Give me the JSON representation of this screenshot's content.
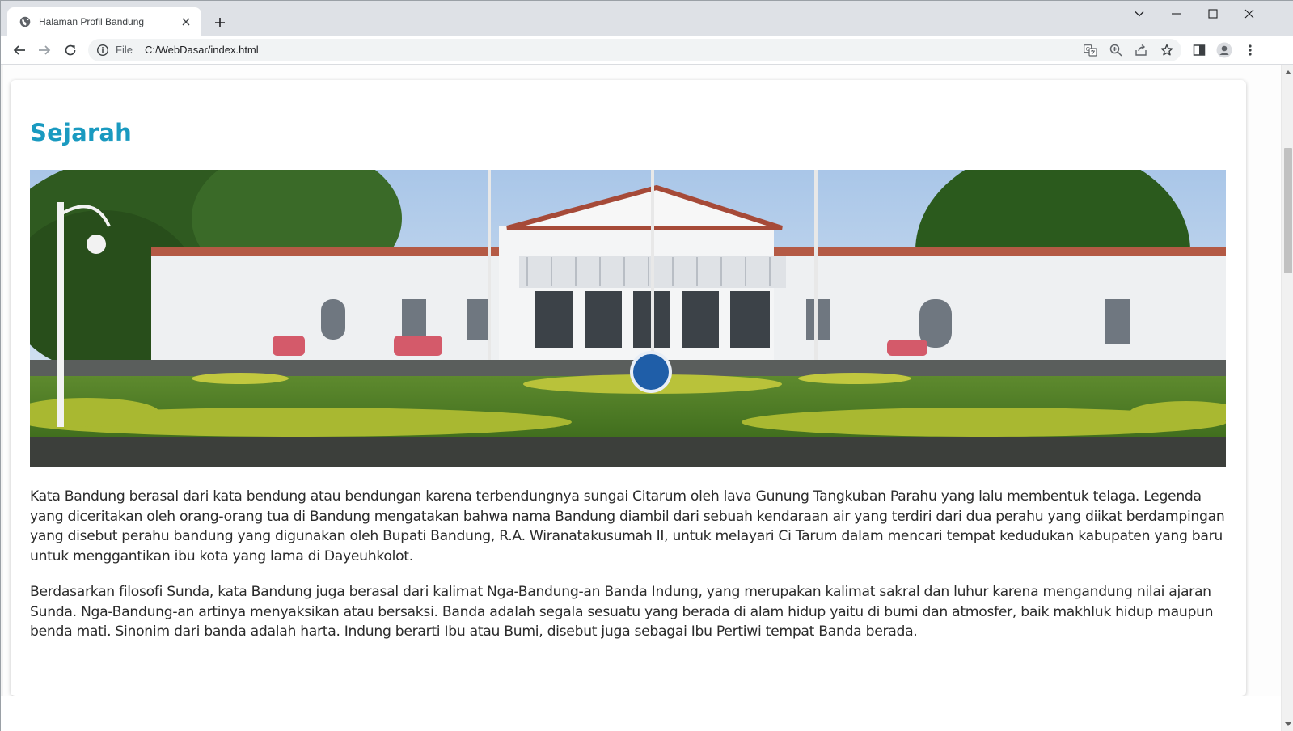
{
  "browser": {
    "tab_title": "Halaman Profil Bandung",
    "address_scheme_label": "File",
    "address_url": "C:/WebDasar/index.html",
    "icons": {
      "favicon": "globe-icon",
      "tab_close": "close-icon",
      "new_tab": "plus-icon",
      "tab_search": "chevron-down-icon",
      "minimize": "minimize-icon",
      "maximize": "maximize-icon",
      "close_window": "close-icon",
      "back": "back-arrow-icon",
      "forward": "forward-arrow-icon",
      "reload": "reload-icon",
      "site_info": "info-icon",
      "translate": "translate-icon",
      "zoom": "zoom-icon",
      "share": "share-icon",
      "bookmark": "star-icon",
      "side_panel": "side-panel-icon",
      "profile": "profile-icon",
      "menu": "kebab-menu-icon"
    }
  },
  "page": {
    "heading": "Sejarah",
    "image_subject": "Gedung Pakuan building with lawn, flagpoles and trees",
    "paragraphs": [
      "Kata Bandung berasal dari kata bendung atau bendungan karena terbendungnya sungai Citarum oleh lava Gunung Tangkuban Parahu yang lalu membentuk telaga. Legenda yang diceritakan oleh orang-orang tua di Bandung mengatakan bahwa nama Bandung diambil dari sebuah kendaraan air yang terdiri dari dua perahu yang diikat berdampingan yang disebut perahu bandung yang digunakan oleh Bupati Bandung, R.A. Wiranatakusumah II, untuk melayari Ci Tarum dalam mencari tempat kedudukan kabupaten yang baru untuk menggantikan ibu kota yang lama di Dayeuhkolot.",
      "Berdasarkan filosofi Sunda, kata Bandung juga berasal dari kalimat Nga-Bandung-an Banda Indung, yang merupakan kalimat sakral dan luhur karena mengandung nilai ajaran Sunda. Nga-Bandung-an artinya menyaksikan atau bersaksi. Banda adalah segala sesuatu yang berada di alam hidup yaitu di bumi dan atmosfer, baik makhluk hidup maupun benda mati. Sinonim dari banda adalah harta. Indung berarti Ibu atau Bumi, disebut juga sebagai Ibu Pertiwi tempat Banda berada."
    ]
  },
  "colors": {
    "heading": "#1a9ac0",
    "tabstrip": "#dee1e6",
    "omnibox": "#f1f3f4"
  }
}
